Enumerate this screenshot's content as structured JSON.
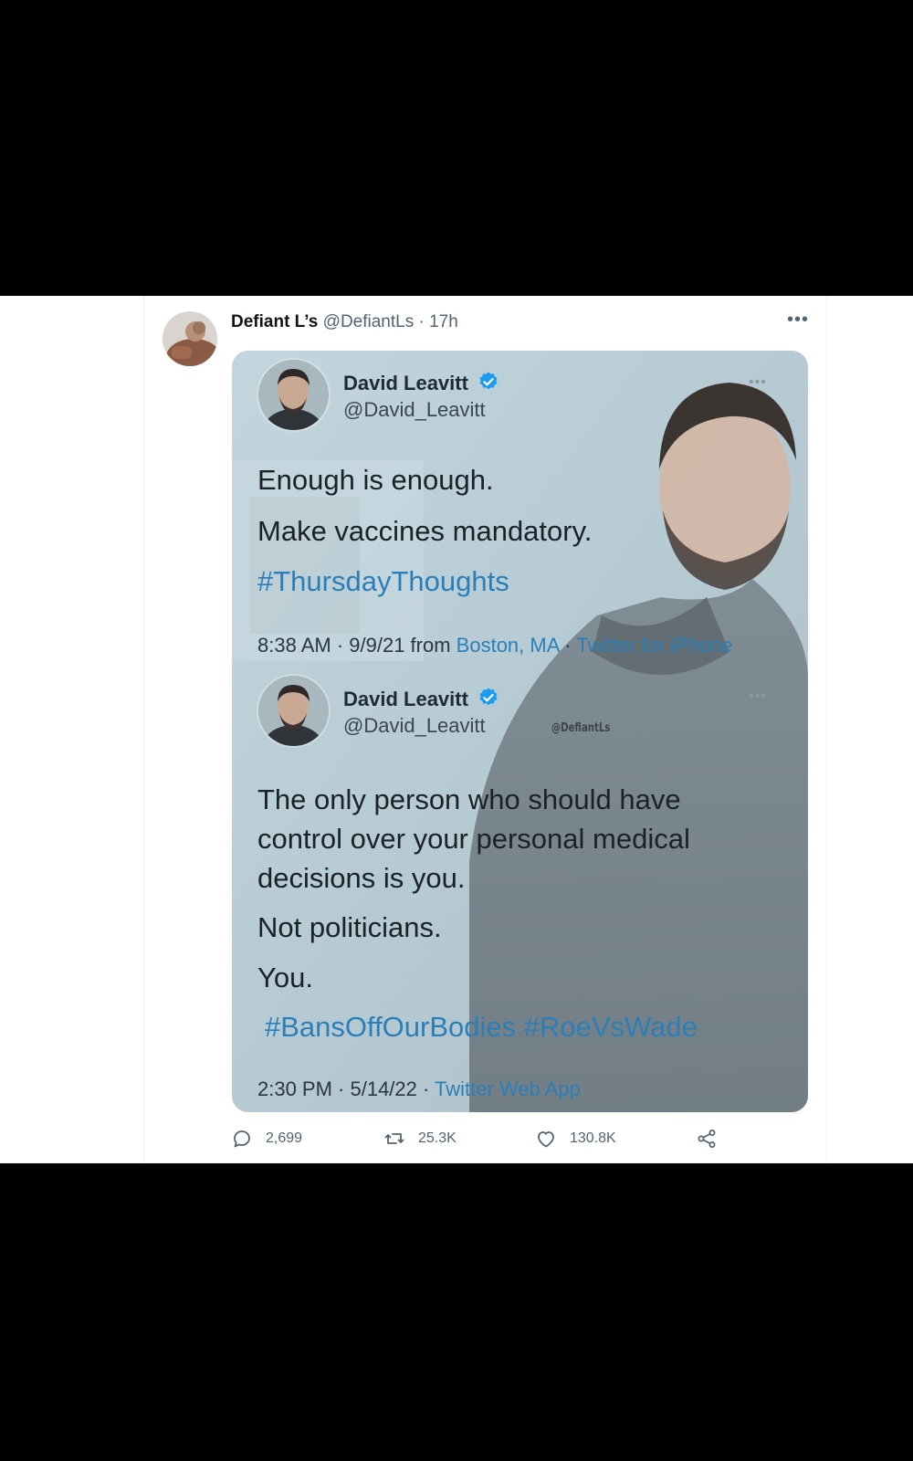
{
  "tweet": {
    "author_name": "Defiant L’s",
    "author_handle": "@DefiantLs",
    "separator": "·",
    "time": "17h",
    "more_label": "•••"
  },
  "quoted": [
    {
      "name": "David Leavitt",
      "handle": "@David_Leavitt",
      "more_label": "•••",
      "lines": [
        "Enough is enough.",
        "Make vaccines mandatory."
      ],
      "hashtags": "#ThursdayThoughts",
      "meta": {
        "time": "8:38 AM · 9/9/21 from ",
        "place": "Boston, MA",
        "sep": " · ",
        "source": "Twitter for iPhone"
      }
    },
    {
      "name": "David Leavitt",
      "handle": "@David_Leavitt",
      "more_label": "•••",
      "lines": [
        "The only person who should have",
        "control over your personal medical",
        "decisions is you.",
        "Not politicians.",
        "You."
      ],
      "hashtags": "#BansOffOurBodies #RoeVsWade",
      "meta": {
        "time": "2:30 PM · 5/14/22 · ",
        "source": "Twitter Web App"
      }
    }
  ],
  "watermark": "@DefiantLs",
  "actions": {
    "replies": "2,699",
    "retweets": "25.3K",
    "likes": "130.8K"
  },
  "icons": {
    "reply": "reply-icon",
    "retweet": "retweet-icon",
    "like": "heart-icon",
    "share": "share-icon",
    "verified": "verified-badge-icon"
  },
  "colors": {
    "link_blue": "#2b7fb8",
    "verified_blue": "#1d9bf0",
    "secondary_text": "#536471"
  }
}
